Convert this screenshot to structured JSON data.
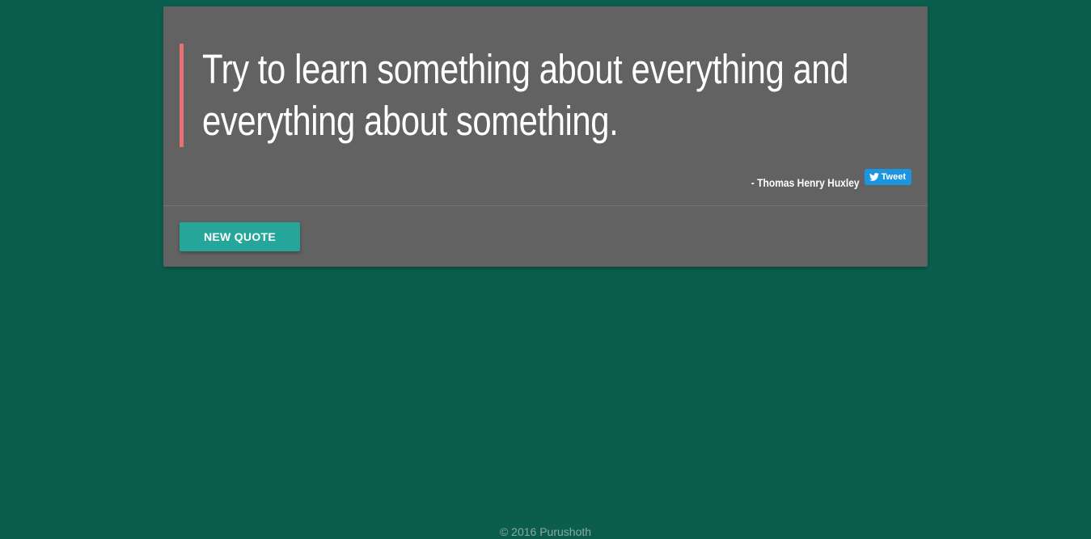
{
  "colors": {
    "background": "#0b5e4d",
    "card": "#626262",
    "quote_border": "#e57373",
    "button": "#26a69a",
    "tweet": "#1b95e0"
  },
  "quote": {
    "text": "Try to learn something about everything and everything about something.",
    "author": "- Thomas Henry Huxley"
  },
  "tweet": {
    "label": "Tweet",
    "icon": "twitter-bird-icon"
  },
  "actions": {
    "new_quote_label": "NEW QUOTE"
  },
  "footer": {
    "text": "© 2016 Purushoth"
  }
}
